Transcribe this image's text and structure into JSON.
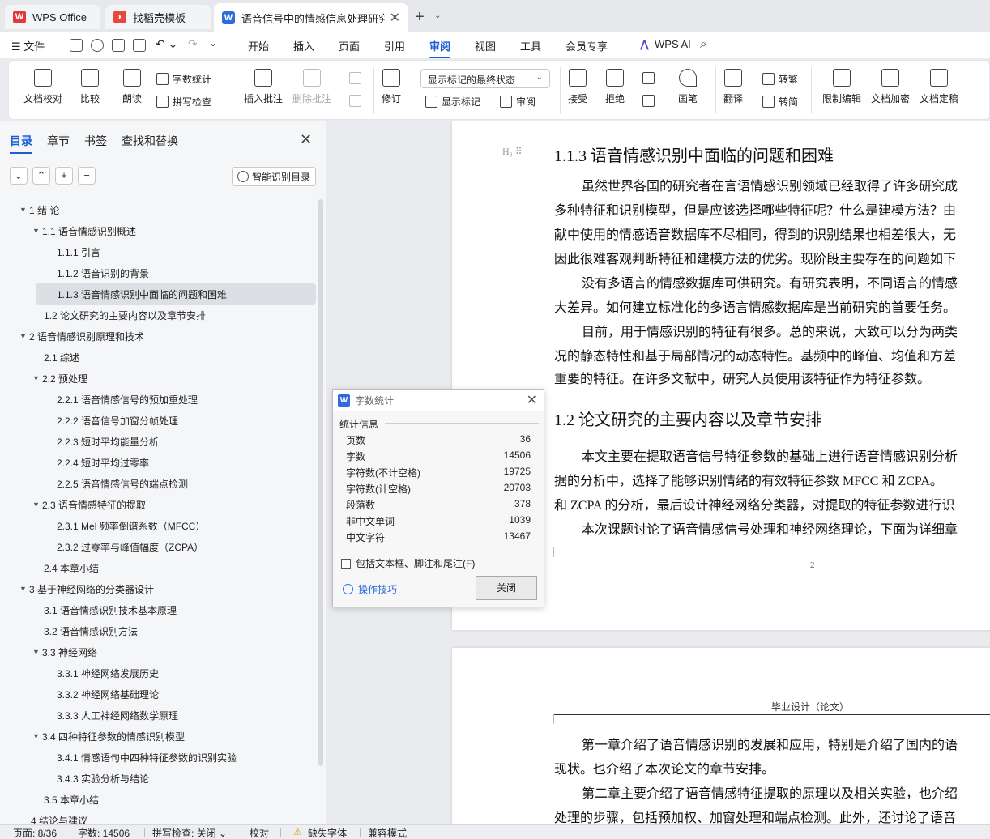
{
  "tabs": [
    {
      "label": "WPS Office",
      "icon": "wps-logo-icon"
    },
    {
      "label": "找稻壳模板",
      "icon": "docer-icon"
    },
    {
      "label": "语音信号中的情感信息处理研究",
      "icon": "word-doc-icon",
      "active": true
    }
  ],
  "menu": {
    "file": "文件",
    "items": [
      "开始",
      "插入",
      "页面",
      "引用",
      "审阅",
      "视图",
      "工具",
      "会员专享"
    ],
    "active": "审阅",
    "wps_ai": "WPS AI"
  },
  "ribbon": {
    "doc_check": "文档校对",
    "compare": "比较",
    "read_aloud": "朗读",
    "word_count": "字数统计",
    "spell_check": "拼写检查",
    "insert_comment": "插入批注",
    "delete_comment": "删除批注",
    "revise": "修订",
    "markup_state": "显示标记的最终状态",
    "show_markup": "显示标记",
    "review_pane": "审阅",
    "accept": "接受",
    "reject": "拒绝",
    "pen": "画笔",
    "translate": "翻译",
    "to_traditional": "转繁",
    "to_simplified": "转简",
    "restrict_edit": "限制编辑",
    "doc_encrypt": "文档加密",
    "doc_finalize": "文档定稿"
  },
  "panel": {
    "tabs": [
      "目录",
      "章节",
      "书签",
      "查找和替换"
    ],
    "smart_toc": "智能识别目录",
    "toc": [
      {
        "level": 1,
        "text": "1  绪  论",
        "collapsible": true
      },
      {
        "level": 2,
        "text": "1.1  语音情感识别概述",
        "collapsible": true
      },
      {
        "level": 3,
        "text": "1.1.1 引言"
      },
      {
        "level": 3,
        "text": "1.1.2 语音识别的背景"
      },
      {
        "level": 3,
        "text": "1.1.3 语音情感识别中面临的问题和困难",
        "selected": true
      },
      {
        "level": 2,
        "text": "1.2 论文研究的主要内容以及章节安排"
      },
      {
        "level": 1,
        "text": "2  语音情感识别原理和技术",
        "collapsible": true
      },
      {
        "level": 2,
        "text": "2.1 综述"
      },
      {
        "level": 2,
        "text": "2.2  预处理",
        "collapsible": true
      },
      {
        "level": 3,
        "text": "2.2.1 语音情感信号的预加重处理"
      },
      {
        "level": 3,
        "text": "2.2.2 语音信号加窗分帧处理"
      },
      {
        "level": 3,
        "text": "2.2.3  短时平均能量分析"
      },
      {
        "level": 3,
        "text": "2.2.4  短时平均过零率"
      },
      {
        "level": 3,
        "text": "2.2.5  语音情感信号的端点检测"
      },
      {
        "level": 2,
        "text": "2.3 语音情感特征的提取",
        "collapsible": true
      },
      {
        "level": 3,
        "text": "2.3.1 Mel 频率倒谱系数（MFCC）"
      },
      {
        "level": 3,
        "text": "2.3.2 过零率与峰值幅度（ZCPA）"
      },
      {
        "level": 2,
        "text": "2.4 本章小结"
      },
      {
        "level": 1,
        "text": "3  基于神经网络的分类器设计",
        "collapsible": true
      },
      {
        "level": 2,
        "text": "3.1  语音情感识别技术基本原理"
      },
      {
        "level": 2,
        "text": "3.2 语音情感识别方法"
      },
      {
        "level": 2,
        "text": "3.3 神经网络",
        "collapsible": true
      },
      {
        "level": 3,
        "text": "3.3.1 神经网络发展历史"
      },
      {
        "level": 3,
        "text": "3.3.2 神经网络基础理论"
      },
      {
        "level": 3,
        "text": "3.3.3 人工神经网络数学原理"
      },
      {
        "level": 2,
        "text": "3.4 四种特征参数的情感识别模型",
        "collapsible": true
      },
      {
        "level": 3,
        "text": "3.4.1 情感语句中四种特征参数的识别实验"
      },
      {
        "level": 3,
        "text": "3.4.3 实验分析与结论"
      },
      {
        "level": 2,
        "text": "3.5 本章小结"
      },
      {
        "level": 1,
        "text": "4  结论与建议"
      }
    ]
  },
  "document": {
    "page1": {
      "heading1": "1.1.3 语音情感识别中面临的问题和困难",
      "para1": [
        "虽然世界各国的研究者在言语情感识别领域已经取得了许多研究成",
        "多种特征和识别模型，但是应该选择哪些特征呢？什么是建模方法？由",
        "献中使用的情感语音数据库不尽相同，得到的识别结果也相差很大，无",
        "因此很难客观判断特征和建模方法的优劣。现阶段主要存在的问题如下"
      ],
      "para2": [
        "没有多语言的情感数据库可供研究。有研究表明，不同语言的情感",
        "大差异。如何建立标准化的多语言情感数据库是当前研究的首要任务。"
      ],
      "para3": [
        "目前，用于情感识别的特征有很多。总的来说，大致可以分为两类",
        "况的静态特性和基于局部情况的动态特性。基频中的峰值、均值和方差",
        "重要的特征。在许多文献中，研究人员使用该特征作为特征参数。"
      ],
      "heading2": "1.2 论文研究的主要内容以及章节安排",
      "para4": [
        "本文主要在提取语音信号特征参数的基础上进行语音情感识别分析",
        "据的分析中，选择了能够识别情绪的有效特征参数 MFCC 和 ZCPA。",
        "和 ZCPA 的分析，最后设计神经网络分类器，对提取的特征参数进行识"
      ],
      "para5": [
        "本次课题讨论了语音情感信号处理和神经网络理论，下面为详细章"
      ],
      "page_number": "2"
    },
    "page2": {
      "header": "毕业设计（论文）",
      "lines": [
        "第一章介绍了语音情感识别的发展和应用，特别是介绍了国内的语",
        "现状。也介绍了本次论文的章节安排。",
        "第二章主要介绍了语音情感特征提取的原理以及相关实验，也介绍",
        "处理的步骤，包括预加权、加窗处理和端点检测。此外，还讨论了语音"
      ]
    }
  },
  "dialog": {
    "title": "字数统计",
    "group": "统计信息",
    "stats": [
      {
        "label": "页数",
        "value": "36"
      },
      {
        "label": "字数",
        "value": "14506"
      },
      {
        "label": "字符数(不计空格)",
        "value": "19725"
      },
      {
        "label": "字符数(计空格)",
        "value": "20703"
      },
      {
        "label": "段落数",
        "value": "378"
      },
      {
        "label": "非中文单词",
        "value": "1039"
      },
      {
        "label": "中文字符",
        "value": "13467"
      }
    ],
    "checkbox": "包括文本框、脚注和尾注(F)",
    "tips": "操作技巧",
    "close": "关闭"
  },
  "status": {
    "page": "页面: 8/36",
    "words": "字数: 14506",
    "spell": "拼写检查: 关闭",
    "proof": "校对",
    "missing_font": "缺失字体",
    "compat": "兼容模式"
  },
  "colors": {
    "accent": "#1a5fd6",
    "wps_red": "#e23a3a",
    "word_blue": "#2f6bd9"
  }
}
